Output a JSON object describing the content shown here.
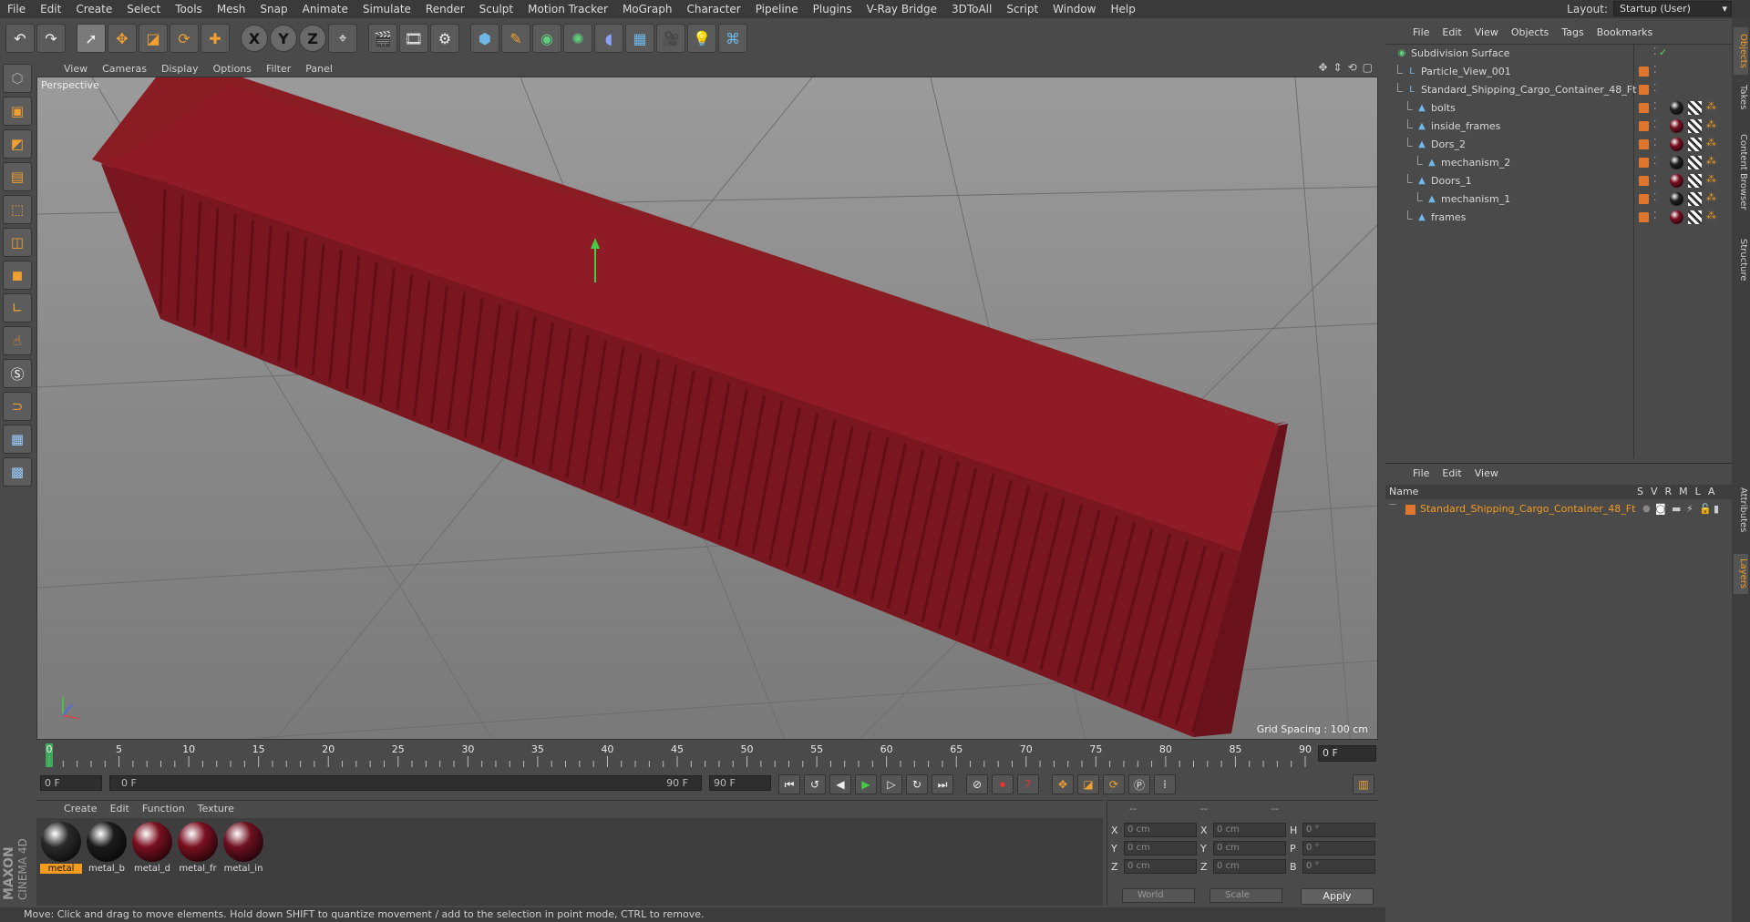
{
  "menu": [
    "File",
    "Edit",
    "Create",
    "Select",
    "Tools",
    "Mesh",
    "Snap",
    "Animate",
    "Simulate",
    "Render",
    "Sculpt",
    "Motion Tracker",
    "MoGraph",
    "Character",
    "Pipeline",
    "Plugins",
    "V-Ray Bridge",
    "3DToAll",
    "Script",
    "Window",
    "Help"
  ],
  "layout": {
    "label": "Layout:",
    "value": "Startup (User)"
  },
  "toolbar": {
    "axis_x": "X",
    "axis_y": "Y",
    "axis_z": "Z"
  },
  "viewport": {
    "menu": [
      "View",
      "Cameras",
      "Display",
      "Options",
      "Filter",
      "Panel"
    ],
    "label": "Perspective",
    "grid_spacing": "Grid Spacing : 100 cm"
  },
  "timeline": {
    "ticks": [
      "0",
      "5",
      "10",
      "15",
      "20",
      "25",
      "30",
      "35",
      "40",
      "45",
      "50",
      "55",
      "60",
      "65",
      "70",
      "75",
      "80",
      "85",
      "90"
    ],
    "current_frame": "0 F",
    "start_field": "0 F",
    "range_start": "0 F",
    "range_end": "90 F",
    "end_field": "90 F"
  },
  "materials": {
    "menu": [
      "Create",
      "Edit",
      "Function",
      "Texture"
    ],
    "items": [
      {
        "name": "metal",
        "color": "#2a2a2a",
        "active": true
      },
      {
        "name": "metal_b",
        "color": "#1c1c1c",
        "active": false
      },
      {
        "name": "metal_d",
        "color": "#7a1020",
        "active": false
      },
      {
        "name": "metal_fr",
        "color": "#7a1020",
        "active": false
      },
      {
        "name": "metal_in",
        "color": "#6e1020",
        "active": false
      }
    ]
  },
  "coordinates": {
    "header": [
      "--",
      "--",
      "--"
    ],
    "rows": [
      {
        "a": "X",
        "av": "0 cm",
        "b": "X",
        "bv": "0 cm",
        "c": "H",
        "cv": "0 °"
      },
      {
        "a": "Y",
        "av": "0 cm",
        "b": "Y",
        "bv": "0 cm",
        "c": "P",
        "cv": "0 °"
      },
      {
        "a": "Z",
        "av": "0 cm",
        "b": "Z",
        "bv": "0 cm",
        "c": "B",
        "cv": "0 °"
      }
    ],
    "world": "World",
    "scale": "Scale",
    "apply": "Apply"
  },
  "status": "Move: Click and drag to move elements. Hold down SHIFT to quantize movement / add to the selection in point mode, CTRL to remove.",
  "objects": {
    "menu": [
      "File",
      "Edit",
      "View",
      "Objects",
      "Tags",
      "Bookmarks"
    ],
    "items": [
      {
        "name": "Subdivision Surface",
        "level": 0,
        "tag": "none"
      },
      {
        "name": "Particle_View_001",
        "level": 1,
        "tag": "none"
      },
      {
        "name": "Standard_Shipping_Cargo_Container_48_Ft",
        "level": 1,
        "tag": "none"
      },
      {
        "name": "bolts",
        "level": 2,
        "tag": "#222222"
      },
      {
        "name": "inside_frames",
        "level": 2,
        "tag": "#7a1020"
      },
      {
        "name": "Dors_2",
        "level": 2,
        "tag": "#7a1020"
      },
      {
        "name": "mechanism_2",
        "level": 3,
        "tag": "#222222"
      },
      {
        "name": "Doors_1",
        "level": 2,
        "tag": "#7a1020"
      },
      {
        "name": "mechanism_1",
        "level": 3,
        "tag": "#222222"
      },
      {
        "name": "frames",
        "level": 2,
        "tag": "#7a1020"
      }
    ]
  },
  "layers": {
    "menu": [
      "File",
      "Edit",
      "View"
    ],
    "header": {
      "name": "Name",
      "cols": [
        "S",
        "V",
        "R",
        "M",
        "L",
        "A"
      ]
    },
    "row": "Standard_Shipping_Cargo_Container_48_Ft"
  },
  "side_tabs": [
    "Objects",
    "Takes",
    "Content Browser",
    "Structure",
    "Attributes",
    "Layers"
  ],
  "logo": {
    "line1": "MAXON",
    "line2": "CINEMA 4D"
  },
  "colors": {
    "accent": "#f39b1f",
    "container": "#8a1c24",
    "layer": "#e0752d"
  }
}
